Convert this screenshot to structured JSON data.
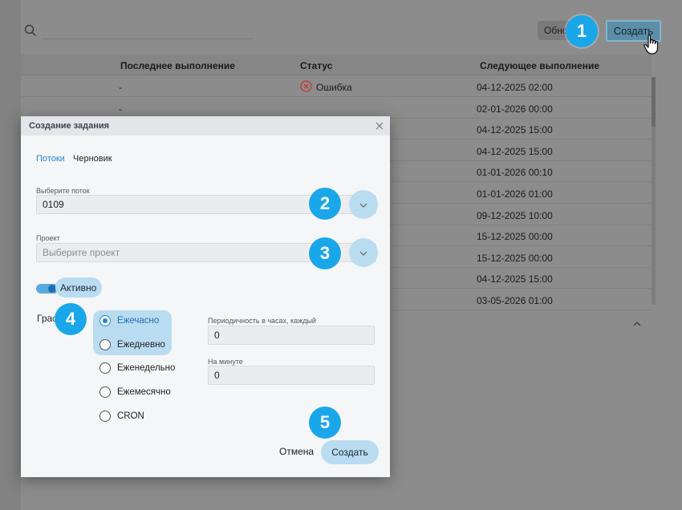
{
  "toolbar": {
    "refresh_label": "Обно",
    "create_label": "Создать"
  },
  "table": {
    "headers": [
      "Последнее выполнение",
      "Статус",
      "Следующее выполнение"
    ],
    "rows": [
      {
        "last": "-",
        "status": "Ошибка",
        "next": "04-12-2025 02:00"
      },
      {
        "last": "-",
        "status": "",
        "next": "02-01-2026 00:00"
      },
      {
        "last": "",
        "status": "",
        "next": "04-12-2025 15:00"
      },
      {
        "last": "",
        "status": "",
        "next": "04-12-2025 15:00"
      },
      {
        "last": "",
        "status": "",
        "next": "01-01-2026 00:10"
      },
      {
        "last": "",
        "status": "",
        "next": "01-01-2026 01:00"
      },
      {
        "last": "",
        "status": "",
        "next": "09-12-2025 10:00"
      },
      {
        "last": "",
        "status": "",
        "next": "15-12-2025 00:00"
      },
      {
        "last": "",
        "status": "",
        "next": "15-12-2025 00:00"
      },
      {
        "last": "",
        "status": "",
        "next": "04-12-2025 15:00"
      },
      {
        "last": "",
        "status": "",
        "next": "03-05-2026 01:00"
      }
    ]
  },
  "modal": {
    "title": "Создание задания",
    "tabs": [
      "Потоки",
      "Черновик"
    ],
    "flow": {
      "label": "Выберите поток",
      "value": "0109"
    },
    "project": {
      "label": "Проект",
      "placeholder": "Выберите проект"
    },
    "active_label": "Активно",
    "schedule_label": "Граф",
    "schedule_options": [
      "Ежечасно",
      "Ежедневно",
      "Еженедельно",
      "Ежемесячно",
      "CRON"
    ],
    "selected_option": "Ежечасно",
    "period": {
      "label": "Периодичность в часах, каждый",
      "value": "0"
    },
    "minute": {
      "label": "На минуте",
      "value": "0"
    },
    "cancel_label": "Отмена",
    "submit_label": "Создать"
  },
  "steps": [
    "1",
    "2",
    "3",
    "4",
    "5"
  ],
  "colors": {
    "accent": "#1e88d4",
    "step": "#1aa7ea",
    "highlight": "#b9dcf1",
    "error": "#c0392b"
  }
}
